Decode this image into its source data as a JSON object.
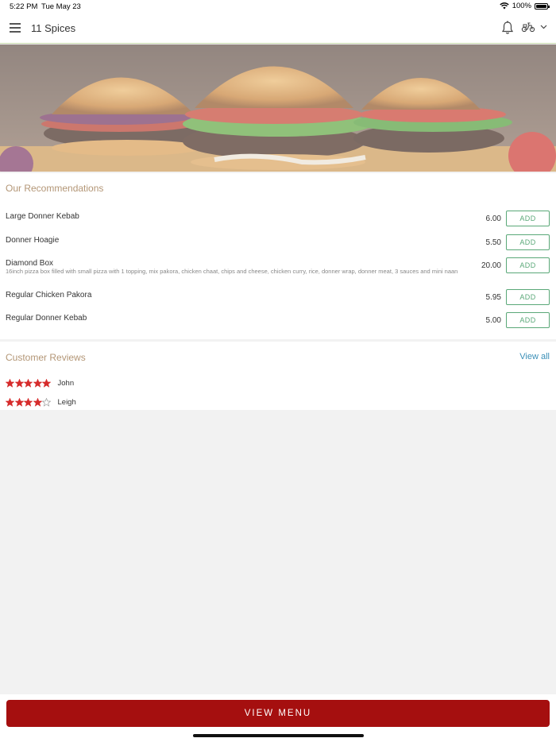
{
  "status_bar": {
    "time": "5:22 PM",
    "date": "Tue May 23",
    "battery_text": "100%",
    "icons": [
      "wifi-icon",
      "battery-icon"
    ]
  },
  "header": {
    "title": "11 Spices",
    "icons": [
      "hamburger-menu-icon",
      "bell-icon",
      "scooter-icon",
      "chevron-down-icon"
    ]
  },
  "hero": {
    "description_icon": "burger-photo"
  },
  "recommendations": {
    "title": "Our Recommendations",
    "add_label": "ADD",
    "items": [
      {
        "name": "Large Donner Kebab",
        "price": "6.00",
        "description": ""
      },
      {
        "name": "Donner Hoagie",
        "price": "5.50",
        "description": ""
      },
      {
        "name": "Diamond Box",
        "price": "20.00",
        "description": "16inch pizza box filled with small pizza with 1 topping, mix pakora, chicken chaat, chips and cheese, chicken curry, rice, donner wrap, donner meat, 3 sauces and mini naan"
      },
      {
        "name": "Regular Chicken Pakora",
        "price": "5.95",
        "description": ""
      },
      {
        "name": "Regular Donner Kebab",
        "price": "5.00",
        "description": ""
      }
    ]
  },
  "reviews": {
    "title": "Customer Reviews",
    "view_all": "View all",
    "items": [
      {
        "name": "John",
        "rating": 5,
        "max": 5
      },
      {
        "name": "Leigh",
        "rating": 4,
        "max": 5
      }
    ]
  },
  "colors": {
    "accent_red": "#a50f0f",
    "add_green": "#5aa878",
    "section_title": "#b39676",
    "link_blue": "#3a8fb7",
    "star_red": "#d62c2c"
  },
  "footer": {
    "view_menu": "VIEW MENU"
  }
}
